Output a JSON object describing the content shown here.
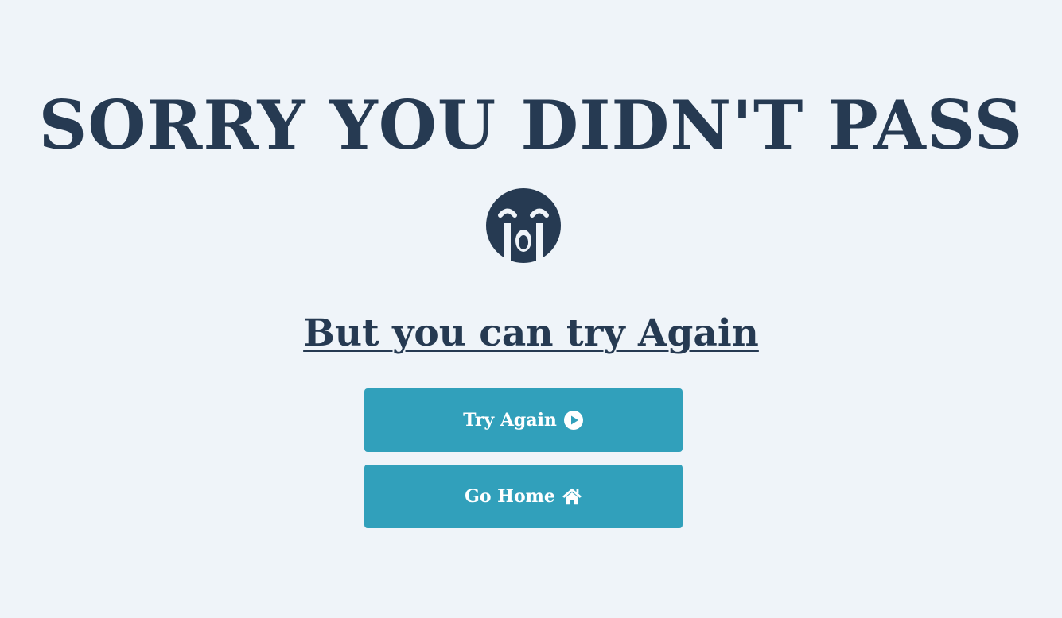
{
  "page": {
    "title": "SORRY YOU DIDN'T PASS",
    "subtitle": "But you can try Again"
  },
  "icons": {
    "face": "sad-cry-icon",
    "try_again": "play-circle-icon",
    "home": "home-icon"
  },
  "buttons": {
    "try_again_label": "Try Again",
    "home_label": "Go Home"
  },
  "colors": {
    "background": "#eff4f9",
    "text": "#263a52",
    "button": "#31a0bb",
    "button_text": "#ffffff"
  }
}
